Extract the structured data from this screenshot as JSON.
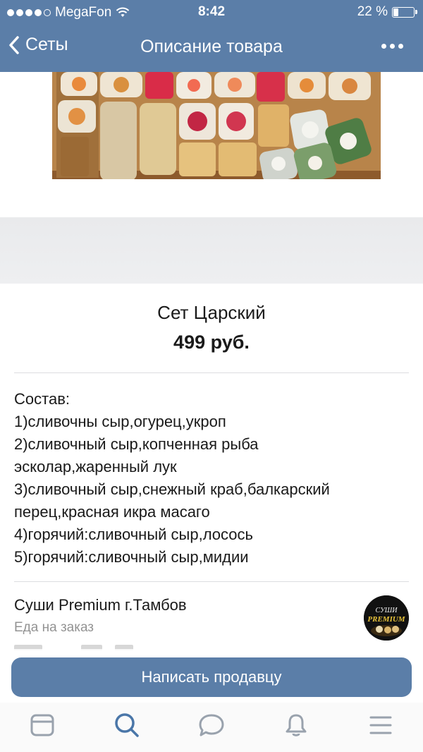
{
  "status_bar": {
    "carrier": "MegaFon",
    "time": "8:42",
    "battery_percent": "22 %",
    "battery_level": 0.22,
    "signal_bars": 4
  },
  "nav": {
    "back_label": "Сеты",
    "title": "Описание товара"
  },
  "product": {
    "name": "Сет Царский",
    "price": "499 руб."
  },
  "description_lines": [
    "Состав:",
    "1)сливочны сыр,огурец,укроп",
    "2)сливочный сыр,копченная рыба",
    "эсколар,жаренный лук",
    "3)сливочный сыр,снежный краб,балкарский",
    "перец,красная икра масаго",
    "4)горячий:сливочный сыр,лосось",
    "5)горячий:сливочный сыр,мидии"
  ],
  "shop": {
    "name": "Суши Premium г.Тамбов",
    "category": "Еда на заказ",
    "logo_text_top": "СУШИ",
    "logo_text_bottom": "PREMIUM"
  },
  "action": {
    "write_seller": "Написать продавцу"
  },
  "tabbar": {
    "icons": [
      "news-icon",
      "search-icon",
      "messages-icon",
      "notifications-icon",
      "menu-icon"
    ],
    "active_color": "#4a76a8",
    "inactive_color": "#99a2ad"
  },
  "colors": {
    "accent": "#5b7ea8"
  }
}
